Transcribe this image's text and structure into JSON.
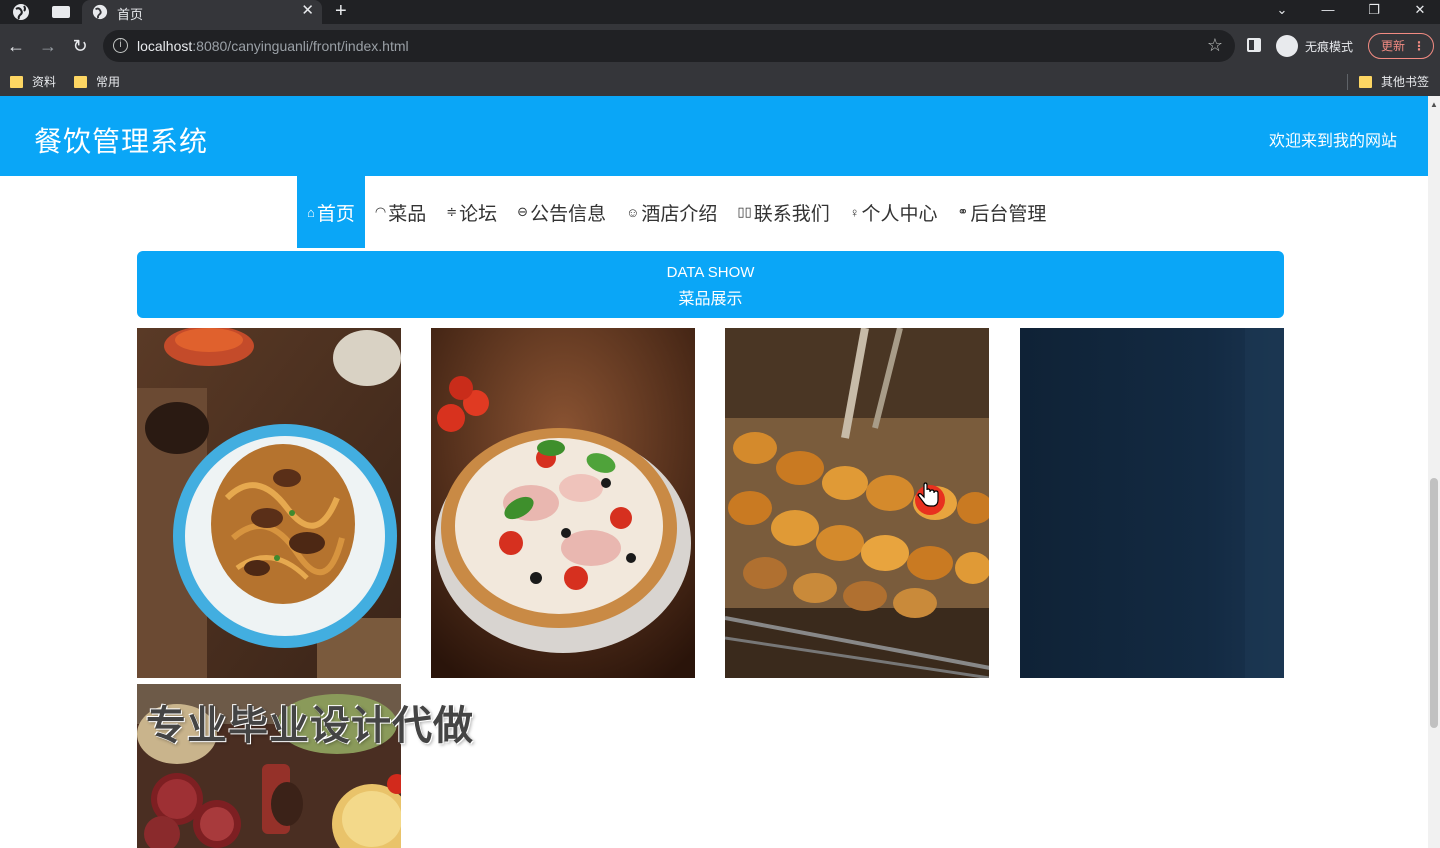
{
  "browser": {
    "tab_title": "首页",
    "url_host": "localhost",
    "url_rest": ":8080/canyinguanli/front/index.html",
    "incognito_label": "无痕模式",
    "update_label": "更新",
    "bookmarks": [
      "资料",
      "常用"
    ],
    "other_bookmarks": "其他书签"
  },
  "site": {
    "title": "餐饮管理系统",
    "welcome": "欢迎来到我的网站"
  },
  "nav": [
    {
      "label": "首页",
      "icon": "home-icon",
      "glyph": "⌂",
      "active": true
    },
    {
      "label": "菜品",
      "icon": "dashboard-icon",
      "glyph": "◠",
      "active": false
    },
    {
      "label": "论坛",
      "icon": "sliders-icon",
      "glyph": "≑",
      "active": false
    },
    {
      "label": "公告信息",
      "icon": "notice-icon",
      "glyph": "⊖",
      "active": false
    },
    {
      "label": "酒店介绍",
      "icon": "face-icon",
      "glyph": "☺",
      "active": false
    },
    {
      "label": "联系我们",
      "icon": "contacts-icon",
      "glyph": "▯▯",
      "active": false
    },
    {
      "label": "个人中心",
      "icon": "user-icon",
      "glyph": "♀",
      "active": false
    },
    {
      "label": "后台管理",
      "icon": "link-icon",
      "glyph": "⚭",
      "active": false
    }
  ],
  "banner": {
    "en": "DATA SHOW",
    "cn": "菜品展示"
  },
  "dishes": [
    {
      "name": "noodle-dish-image"
    },
    {
      "name": "pizza-image"
    },
    {
      "name": "grilled-skewers-image"
    },
    {
      "name": "dark-dish-image"
    },
    {
      "name": "charcuterie-platter-image"
    }
  ],
  "overlay_watermark": "专业毕业设计代做"
}
